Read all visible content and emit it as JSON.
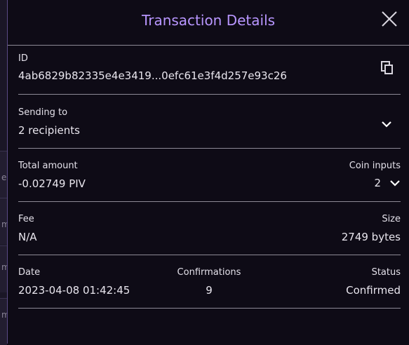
{
  "modal": {
    "title": "Transaction Details"
  },
  "id_row": {
    "label": "ID",
    "value": "4ab6829b82335e4e3419...0efc61e3f4d257e93c26"
  },
  "sending_row": {
    "label": "Sending to",
    "value": "2 recipients"
  },
  "amount_row": {
    "total_label": "Total amount",
    "total_value": "-0.02749 PIV",
    "coin_label": "Coin inputs",
    "coin_value": "2"
  },
  "fee_row": {
    "fee_label": "Fee",
    "fee_value": "N/A",
    "size_label": "Size",
    "size_value": "2749 bytes"
  },
  "date_row": {
    "date_label": "Date",
    "date_value": "2023-04-08 01:42:45",
    "conf_label": "Confirmations",
    "conf_value": "9",
    "status_label": "Status",
    "status_value": "Confirmed"
  },
  "background": {
    "chars": [
      "er",
      "m",
      "m",
      "m"
    ]
  },
  "colors": {
    "title": "#b896ff",
    "background": "#0e0b16",
    "divider": "#8d8a96"
  },
  "icons": [
    "close-icon",
    "copy-icon",
    "chevron-down-icon"
  ]
}
